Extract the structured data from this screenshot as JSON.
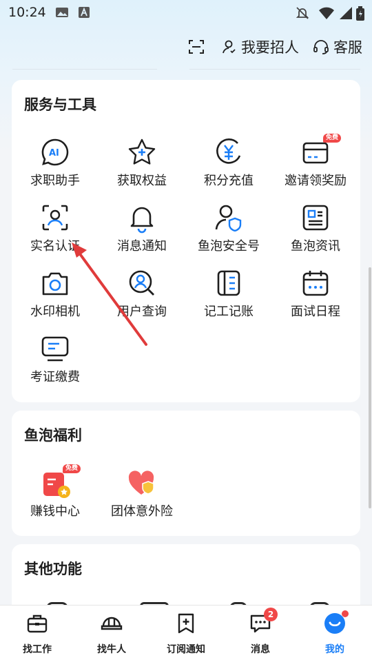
{
  "status_bar": {
    "time": "10:24"
  },
  "header": {
    "recruit_label": "我要招人",
    "service_label": "客服"
  },
  "service_tools": {
    "title": "服务与工具",
    "items": [
      {
        "label": "求职助手",
        "icon": "ai-chat-icon"
      },
      {
        "label": "获取权益",
        "icon": "star-plus-icon"
      },
      {
        "label": "积分充值",
        "icon": "yuan-coin-icon"
      },
      {
        "label": "邀请领奖励",
        "icon": "gift-card-icon",
        "badge": "免费"
      },
      {
        "label": "实名认证",
        "icon": "face-scan-icon"
      },
      {
        "label": "消息通知",
        "icon": "bell-icon"
      },
      {
        "label": "鱼泡安全号",
        "icon": "user-shield-icon"
      },
      {
        "label": "鱼泡资讯",
        "icon": "news-icon"
      },
      {
        "label": "水印相机",
        "icon": "camera-icon"
      },
      {
        "label": "用户查询",
        "icon": "user-search-icon"
      },
      {
        "label": "记工记账",
        "icon": "ledger-icon"
      },
      {
        "label": "面试日程",
        "icon": "calendar-icon"
      },
      {
        "label": "考证缴费",
        "icon": "monitor-icon"
      }
    ]
  },
  "welfare": {
    "title": "鱼泡福利",
    "items": [
      {
        "label": "赚钱中心",
        "icon": "earn-money-icon",
        "badge": "免费"
      },
      {
        "label": "团体意外险",
        "icon": "heart-shield-icon"
      }
    ]
  },
  "other": {
    "title": "其他功能"
  },
  "bottom_nav": [
    {
      "label": "找工作",
      "icon": "briefcase-icon"
    },
    {
      "label": "找牛人",
      "icon": "helmet-icon"
    },
    {
      "label": "订阅通知",
      "icon": "bookmark-plus-icon"
    },
    {
      "label": "消息",
      "icon": "message-icon",
      "badge": "2"
    },
    {
      "label": "我的",
      "icon": "smile-icon",
      "active": true
    }
  ],
  "colors": {
    "accent": "#1a7ef7",
    "badge": "#f04848",
    "icon_stroke": "#1e1e1e"
  }
}
